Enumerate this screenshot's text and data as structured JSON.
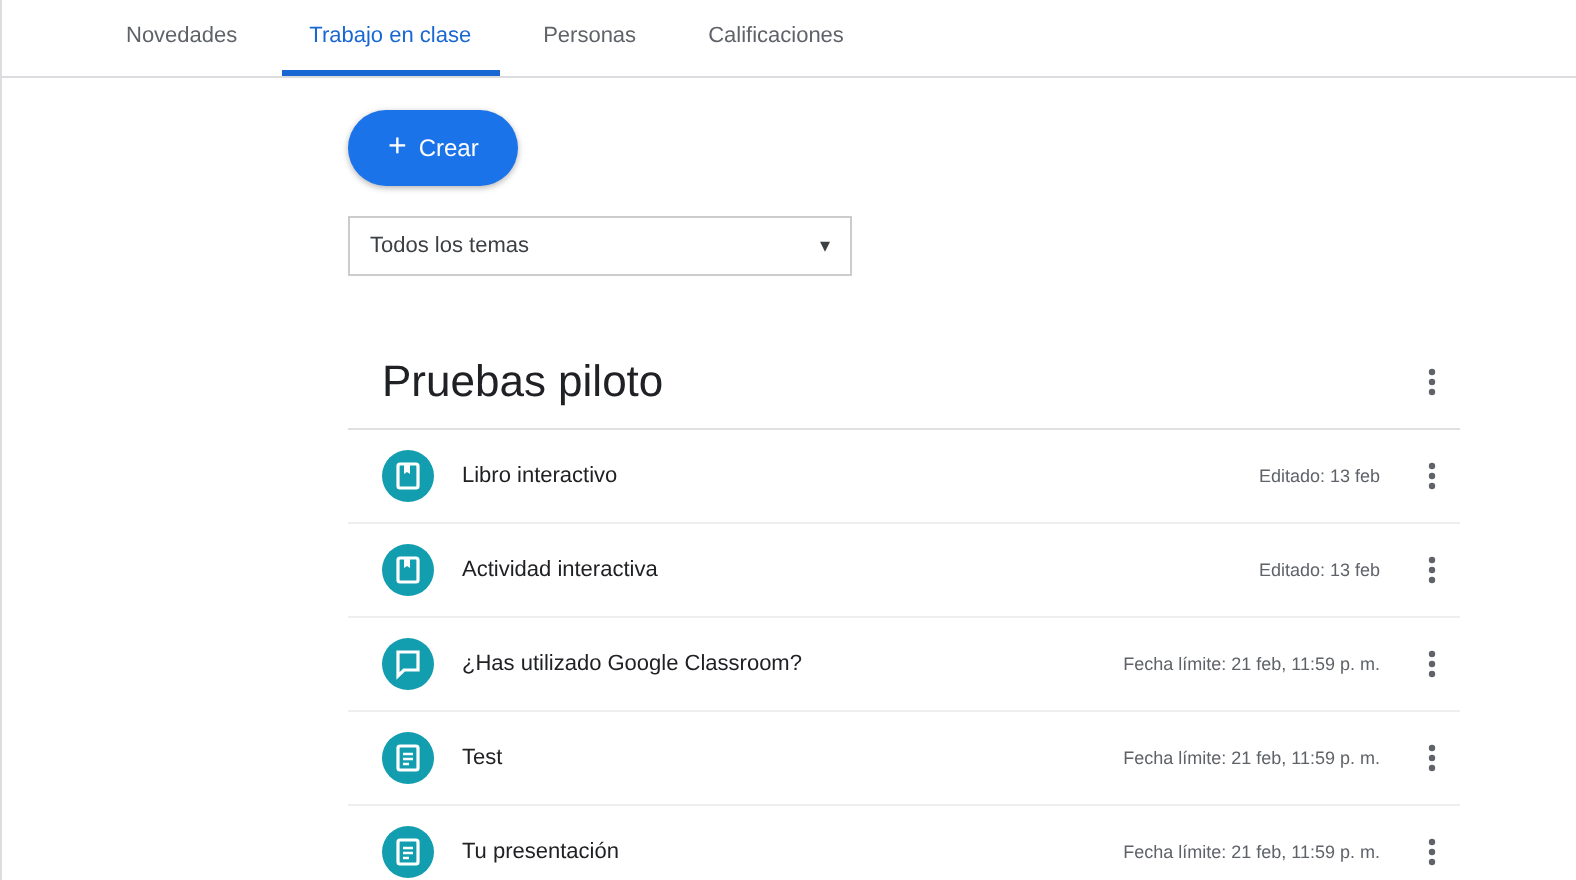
{
  "tabs": [
    {
      "label": "Novedades",
      "selected": false
    },
    {
      "label": "Trabajo en clase",
      "selected": true
    },
    {
      "label": "Personas",
      "selected": false
    },
    {
      "label": "Calificaciones",
      "selected": false
    }
  ],
  "create_button": {
    "icon": "+",
    "label": "Crear"
  },
  "topic_filter": {
    "value": "Todos los temas",
    "caret": "▾"
  },
  "topic": {
    "title": "Pruebas piloto",
    "items": [
      {
        "kind": "material",
        "title": "Libro interactivo",
        "meta": "Editado: 13 feb"
      },
      {
        "kind": "material",
        "title": "Actividad interactiva",
        "meta": "Editado: 13 feb"
      },
      {
        "kind": "question",
        "title": "¿Has utilizado Google Classroom?",
        "meta": "Fecha límite: 21 feb, 11:59 p. m."
      },
      {
        "kind": "assignment",
        "title": "Test",
        "meta": "Fecha límite: 21 feb, 11:59 p. m."
      },
      {
        "kind": "assignment",
        "title": "Tu presentación",
        "meta": "Fecha límite: 21 feb, 11:59 p. m."
      }
    ]
  }
}
